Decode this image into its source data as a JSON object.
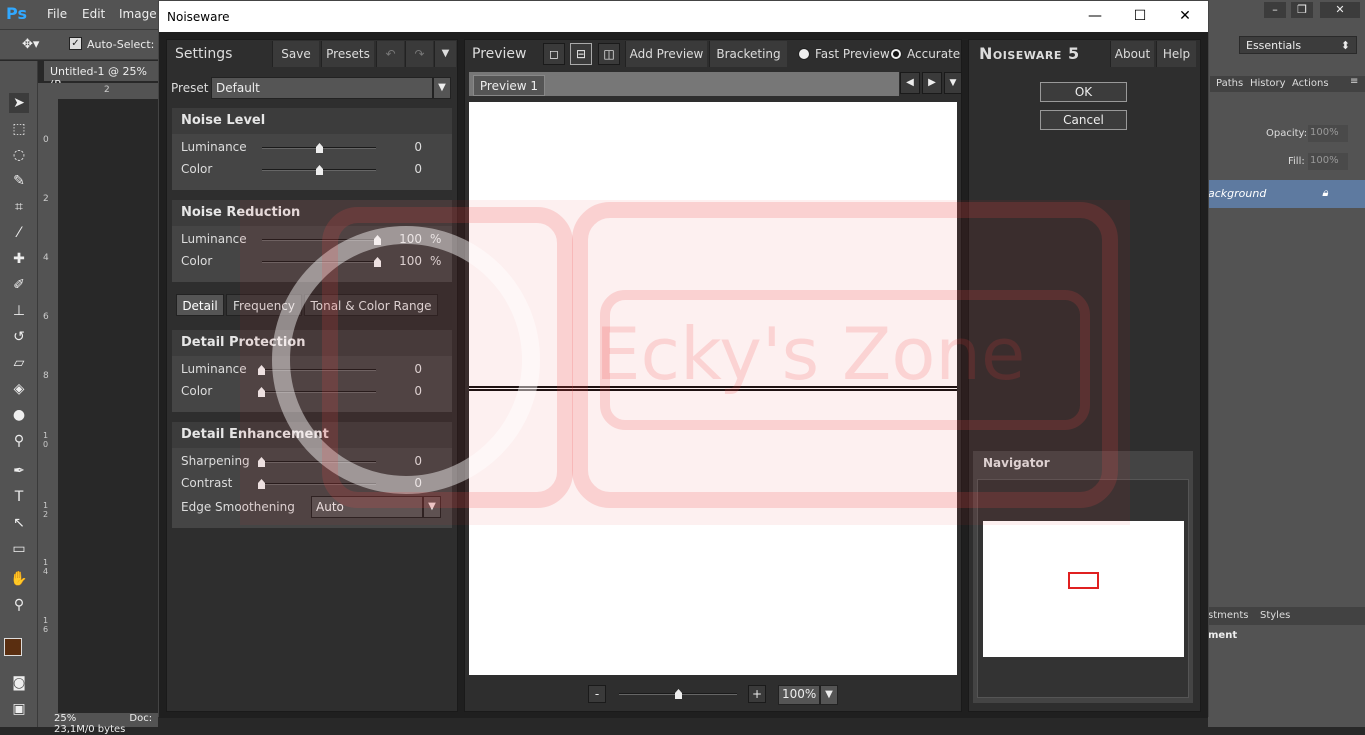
{
  "photoshop": {
    "menu": [
      "File",
      "Edit",
      "Image"
    ],
    "logo": "Ps",
    "options": {
      "auto_select": "Auto-Select:"
    },
    "doc_tab": "Untitled-1 @ 25% (R",
    "status_zoom": "25%",
    "status_doc": "Doc: 23,1M/0 bytes",
    "workspace": "Essentials",
    "panel_tabs": [
      "Paths",
      "History",
      "Actions"
    ],
    "opacity_label": "Opacity:",
    "opacity_value": "100%",
    "fill_label": "Fill:",
    "fill_value": "100%",
    "layer_name": "ackground",
    "adj_tabs": [
      "stments",
      "Styles"
    ],
    "adj_label": "ment",
    "ruler_numbers": [
      "0",
      "2",
      "4",
      "6",
      "8",
      "1 0",
      "1 2",
      "1 4",
      "1 6"
    ],
    "ruler_top": "2"
  },
  "dialog": {
    "title": "Noiseware",
    "window_controls": {
      "minimize": "—",
      "maximize": "☐",
      "close": "✕"
    }
  },
  "settings": {
    "title": "Settings",
    "save": "Save",
    "presets": "Presets",
    "preset_label": "Preset",
    "preset_value": "Default",
    "noise_level": {
      "title": "Noise Level",
      "luminance_label": "Luminance",
      "luminance_value": "0",
      "luminance_pos": 0.5,
      "color_label": "Color",
      "color_value": "0",
      "color_pos": 0.5
    },
    "noise_reduction": {
      "title": "Noise Reduction",
      "luminance_label": "Luminance",
      "luminance_value": "100",
      "luminance_unit": "%",
      "luminance_pos": 1.0,
      "color_label": "Color",
      "color_value": "100",
      "color_unit": "%",
      "color_pos": 1.0
    },
    "tabs": [
      "Detail",
      "Frequency",
      "Tonal & Color Range"
    ],
    "detail_protection": {
      "title": "Detail Protection",
      "luminance_label": "Luminance",
      "luminance_value": "0",
      "color_label": "Color",
      "color_value": "0"
    },
    "detail_enhancement": {
      "title": "Detail Enhancement",
      "sharpening_label": "Sharpening",
      "sharpening_value": "0",
      "contrast_label": "Contrast",
      "contrast_value": "0",
      "edge_label": "Edge Smoothening",
      "edge_value": "Auto"
    }
  },
  "preview": {
    "title": "Preview",
    "add_preview": "Add Preview",
    "bracketing": "Bracketing",
    "fast_preview": "Fast Preview",
    "accurate": "Accurate",
    "tab": "Preview 1",
    "zoom_minus": "-",
    "zoom_plus": "+",
    "zoom_value": "100%"
  },
  "right": {
    "brand_main": "Noiseware",
    "brand_num": "5",
    "about": "About",
    "help": "Help",
    "ok": "OK",
    "cancel": "Cancel",
    "navigator": "Navigator"
  },
  "watermark": {
    "text": "Ecky's Zone"
  },
  "colors": {
    "accent": "#31a8ff",
    "nav_rect": "#e02020",
    "foreground_swatch": "#5a2e10"
  }
}
